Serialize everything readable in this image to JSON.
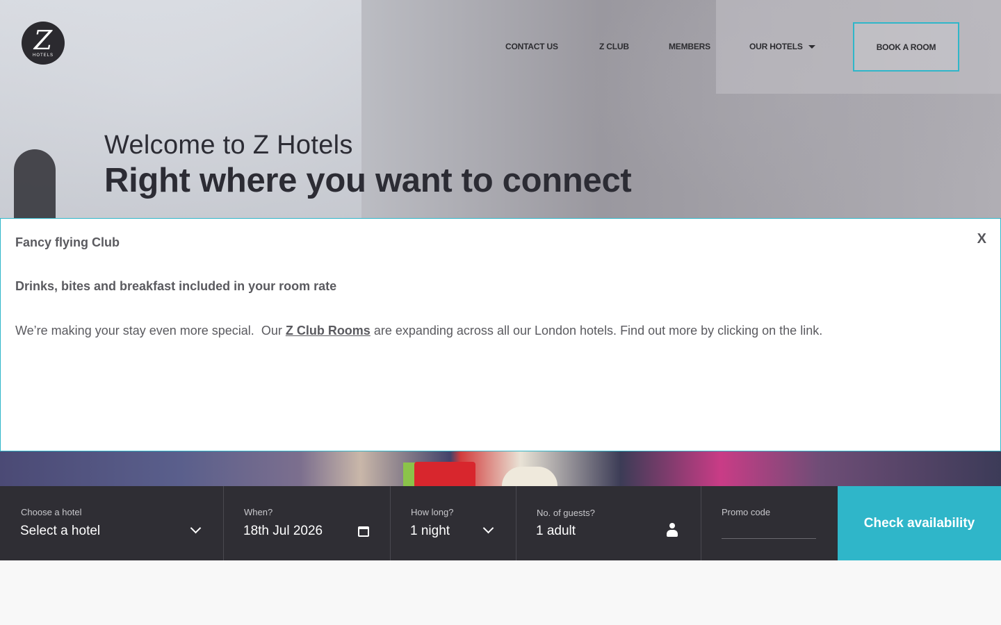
{
  "brand": {
    "logo_letter": "Z",
    "logo_word": "HOTELS"
  },
  "nav": {
    "items": [
      {
        "label": "CONTACT US"
      },
      {
        "label": "Z CLUB"
      },
      {
        "label": "MEMBERS"
      },
      {
        "label": "OUR HOTELS",
        "has_dropdown": true
      }
    ],
    "cta_label": "BOOK A ROOM"
  },
  "hero": {
    "welcome": "Welcome to Z Hotels",
    "tagline": "Right where you want to connect"
  },
  "popup": {
    "close_label": "X",
    "title": "Fancy flying Club",
    "subtitle": "Drinks, bites and breakfast included in your room rate",
    "body_before": "We’re making your stay even more special.  Our ",
    "body_link": "Z Club Rooms",
    "body_after": " are expanding across all our London hotels. Find out more by clicking on the link."
  },
  "booking": {
    "hotel": {
      "label": "Choose a hotel",
      "value": "Select a hotel"
    },
    "when": {
      "label": "When?",
      "value": "18th Jul 2026"
    },
    "duration": {
      "label": "How long?",
      "value": "1 night"
    },
    "guests": {
      "label": "No. of guests?",
      "value": "1 adult"
    },
    "promo": {
      "label": "Promo code",
      "value": ""
    },
    "submit_label": "Check availability"
  },
  "colors": {
    "accent": "#2fb6c9",
    "bar": "#2f2e34",
    "text_dark": "#2c2c34",
    "popup_text": "#5a5a5f"
  },
  "icons": [
    "chevron-down-icon",
    "calendar-icon",
    "user-icon",
    "caret-down-icon"
  ]
}
